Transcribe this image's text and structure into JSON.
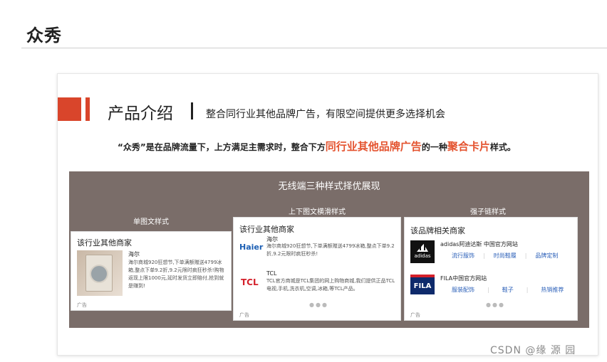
{
  "page": {
    "heading": "众秀",
    "watermark": "CSDN @缘 源 园"
  },
  "slide": {
    "title": "产品介绍",
    "separator": "|",
    "subtitle": "整合同行业其他品牌广告，有限空间提供更多选择机会",
    "intro": {
      "quote": "“众秀”",
      "part1": "是在品牌流量下，上方满足主需求时，整合下方",
      "highlight1": "同行业其他品牌广告",
      "part2": "的一种",
      "highlight2": "聚合卡片",
      "part3": "样式。"
    },
    "accent_color": "#d9452b",
    "panel_bg": "#7a6d69"
  },
  "panel": {
    "title": "无线端三种样式择优展现",
    "columns": [
      "单图文样式",
      "上下图文横滑样式",
      "强子链样式"
    ]
  },
  "card1": {
    "header": "该行业其他商家",
    "brand": "海尔",
    "desc": "海尔商城920狂想节,下单满额赠送4799冰箱,整点下单9.2折,9.2元限时疯狂秒杀!购物返现上限1000元,延时发货立即赔付,抢到就是赚到!",
    "ad": "广告"
  },
  "card2": {
    "header": "该行业其他商家",
    "items": [
      {
        "logo": "Haier",
        "brand": "海尔",
        "desc": "海尔商城920狂想节,下单满额赠送4799冰箱,整点下单9.2折,9.2元限时疯狂秒杀!"
      },
      {
        "logo": "TCL",
        "brand": "TCL",
        "desc": "TCL官方商城是TCL集团的网上购物商城,我们提供正品TCL电视,手机,洗衣机,空调,冰箱,等TCL产品。"
      }
    ],
    "dots": "●●●",
    "ad": "广告"
  },
  "card3": {
    "header": "该品牌相关商家",
    "brands": [
      {
        "logo": "adidas",
        "name": "adidas阿迪达斯 中国官方网站",
        "links": [
          "流行服饰",
          "时尚鞋履",
          "品牌定制"
        ]
      },
      {
        "logo": "FILA",
        "name": "FILA中国官方网站",
        "links": [
          "服装配饰",
          "鞋子",
          "热销推荐"
        ]
      }
    ],
    "dots": "●●●",
    "ad": "广告"
  }
}
